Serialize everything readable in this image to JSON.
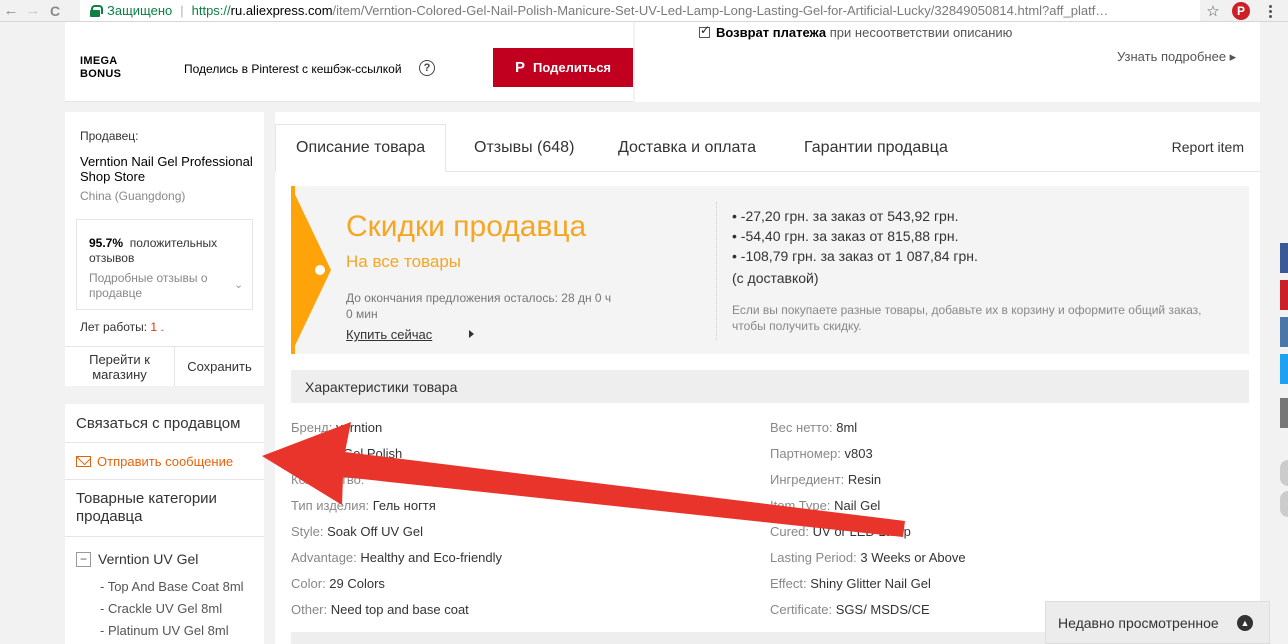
{
  "browser": {
    "back_icon": "←",
    "forward_icon": "→",
    "reload_icon": "C",
    "secure_label": "Защищено",
    "url_scheme": "https://",
    "url_host": "ru.aliexpress.com",
    "url_path": "/item/Verntion-Colored-Gel-Nail-Polish-Manicure-Set-UV-Led-Lamp-Long-Lasting-Gel-for-Artificial-Lucky/32849050814.html?aff_platf…",
    "star_icon": "☆",
    "pinterest_ext_label": "P"
  },
  "share_bar": {
    "mega_bonus_line1": "IMEGA",
    "mega_bonus_line2": "BONUS",
    "share_text": "Поделись в Pinterest с кешбэк-ссылкой",
    "help_icon": "?",
    "pin_icon": "P",
    "pin_button_label": "Поделиться"
  },
  "buyer_protection": {
    "refund_bold": "Возврат платежа",
    "refund_rest": "при несоответствии описанию",
    "learn_more": "Узнать подробнее ▸"
  },
  "seller": {
    "label": "Продавец:",
    "name": "Verntion Nail Gel Professional Shop Store",
    "location": "China (Guangdong)",
    "feedback_pct": "95.7%",
    "feedback_text": "положительных отзывов",
    "feedback_detail": "Подробные отзывы о продавце",
    "chevron_icon": "⌄",
    "years_label": "Лет работы:",
    "years_value": "1",
    "years_dot": " .",
    "go_store": "Перейти к магазину",
    "save": "Сохранить"
  },
  "contact": {
    "title": "Связаться с продавцом",
    "send_message": "Отправить сообщение",
    "categories_title": "Товарные категории продавца",
    "group_toggle": "−",
    "group_name": "Verntion UV Gel",
    "subcategories": [
      "- Top And Base Coat 8ml",
      "- Crackle UV Gel 8ml",
      "- Platinum UV Gel 8ml"
    ]
  },
  "tabs": [
    {
      "label": "Описание товара",
      "active": true
    },
    {
      "label": "Отзывы (648)",
      "active": false
    },
    {
      "label": "Доставка и оплата",
      "active": false
    },
    {
      "label": "Гарантии продавца",
      "active": false
    }
  ],
  "report_item": "Report item",
  "promo": {
    "title": "Скидки продавца",
    "subtitle": "На все товары",
    "remaining": "До окончания предложения осталось: 28 дн 0 ч 0 мин",
    "buy_now": "Купить сейчас",
    "discounts": [
      "• -27,20 грн. за заказ от 543,92 грн.",
      "• -54,40 грн. за заказ от 815,88 грн.",
      "• -108,79 грн. за заказ от 1 087,84 грн."
    ],
    "with_delivery": "(с доставкой)",
    "note": "Если вы покупаете разные товары, добавьте их в корзину и оформите общий заказ, чтобы получить скидку.",
    "accent_color": "#ffa30b"
  },
  "specs": {
    "heading": "Характеристики товара",
    "left": [
      {
        "k": "Бренд:",
        "v": " verntion"
      },
      {
        "k": "",
        "v": "Gel Polish"
      },
      {
        "k": "Количество:",
        "v": ""
      },
      {
        "k": "Тип изделия:",
        "v": " Гель ногтя"
      },
      {
        "k": "Style:",
        "v": " Soak Off UV Gel"
      },
      {
        "k": "Advantage:",
        "v": " Healthy and Eco-friendly"
      },
      {
        "k": "Color:",
        "v": " 29 Colors"
      },
      {
        "k": "Other:",
        "v": " Need top and base coat"
      }
    ],
    "right": [
      {
        "k": "Вес нетто:",
        "v": " 8ml"
      },
      {
        "k": "Партномер:",
        "v": " v803"
      },
      {
        "k": "Ингредиент:",
        "v": " Resin"
      },
      {
        "k": "Item Type:",
        "v": " Nail Gel"
      },
      {
        "k": "Cured:",
        "v": " UV or LED Lamp"
      },
      {
        "k": "Lasting Period:",
        "v": " 3 Weeks or Above"
      },
      {
        "k": "Effect:",
        "v": " Shiny Glitter Nail Gel"
      },
      {
        "k": "Certificate:",
        "v": " SGS/ MSDS/CE"
      }
    ]
  },
  "recently_viewed": {
    "label": "Недавно просмотренное",
    "toggle_icon": "▲"
  },
  "colors": {
    "pin_red": "#c0001e",
    "arrow_red": "#e8342b",
    "accent_orange": "#e8620b"
  }
}
